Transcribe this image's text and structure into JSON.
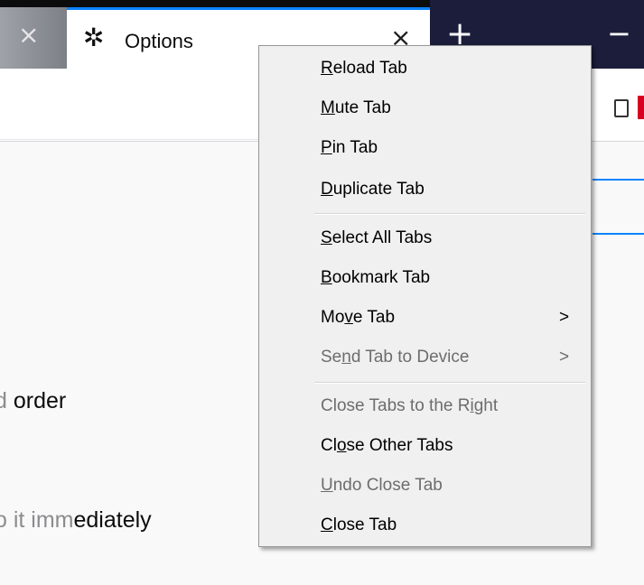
{
  "tabs": {
    "prev_close": "×",
    "active_title": "Options",
    "active_close": "×",
    "new_tab": "+",
    "minimize": "−"
  },
  "content": {
    "line1_faded": "d ",
    "line1": "order",
    "line2_faded": "o it imm",
    "line2": "ediately"
  },
  "menu": {
    "items": [
      {
        "pre": "",
        "ul": "R",
        "post": "eload Tab",
        "disabled": false
      },
      {
        "pre": "",
        "ul": "M",
        "post": "ute Tab",
        "disabled": false
      },
      {
        "pre": "",
        "ul": "P",
        "post": "in Tab",
        "disabled": false
      },
      {
        "pre": "",
        "ul": "D",
        "post": "uplicate Tab",
        "disabled": false
      },
      {
        "pre": "",
        "ul": "S",
        "post": "elect All Tabs",
        "disabled": false
      },
      {
        "pre": "",
        "ul": "B",
        "post": "ookmark Tab",
        "disabled": false
      },
      {
        "pre": "Mo",
        "ul": "v",
        "post": "e Tab",
        "disabled": false,
        "arrow": ">"
      },
      {
        "pre": "Se",
        "ul": "n",
        "post": "d Tab to Device",
        "disabled": true,
        "arrow": ">"
      },
      {
        "pre": "Close Tabs to the R",
        "ul": "i",
        "post": "ght",
        "disabled": true
      },
      {
        "pre": "Cl",
        "ul": "o",
        "post": "se Other Tabs",
        "disabled": false
      },
      {
        "pre": "",
        "ul": "U",
        "post": "ndo Close Tab",
        "disabled": true
      },
      {
        "pre": "",
        "ul": "C",
        "post": "lose Tab",
        "disabled": false
      }
    ]
  }
}
